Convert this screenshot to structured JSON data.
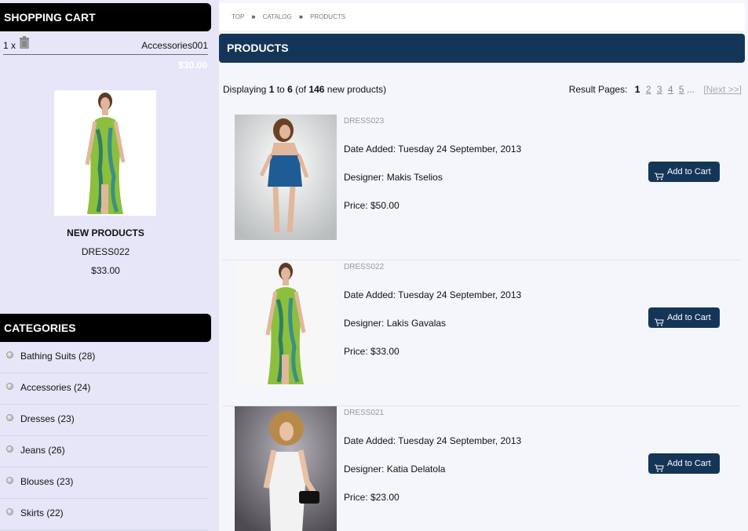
{
  "sidebar": {
    "cart": {
      "title": "Shopping Cart",
      "qty": "1 x",
      "item_name": "Accessories001",
      "total": "$30.00"
    },
    "new_products": {
      "title": "New Products",
      "name": "DRESS022",
      "price": "$33.00"
    },
    "categories": {
      "title": "Categories",
      "items": [
        {
          "label": "Bathing Suits (28)"
        },
        {
          "label": "Accessories (24)"
        },
        {
          "label": "Dresses (23)"
        },
        {
          "label": "Jeans (26)"
        },
        {
          "label": "Blouses (23)"
        },
        {
          "label": "Skirts (22)"
        }
      ]
    }
  },
  "main": {
    "breadcrumb": [
      "Top",
      "Catalog",
      "Products"
    ],
    "breadcrumb_sep": "»",
    "header": "Products",
    "displaying": {
      "prefix": "Displaying ",
      "from": "1",
      "to_word": " to ",
      "to": "6",
      "of_word": " (of ",
      "total": "146",
      "suffix": " new products)"
    },
    "result_pages": {
      "label": "Result Pages:",
      "pages": [
        "1",
        "2",
        "3",
        "4",
        "5"
      ],
      "current": "1",
      "dots": "...",
      "next": "[Next >>]"
    },
    "products": [
      {
        "code": "DRESS023",
        "date": "Date Added: Tuesday 24 September, 2013",
        "designer": "Designer: Makis Tselios",
        "price": "Price: $50.00",
        "button": "Add to Cart"
      },
      {
        "code": "DRESS022",
        "date": "Date Added: Tuesday 24 September, 2013",
        "designer": "Designer: Lakis Gavalas",
        "price": "Price: $33.00",
        "button": "Add to Cart"
      },
      {
        "code": "DRESS021",
        "date": "Date Added: Tuesday 24 September, 2013",
        "designer": "Designer: Katia Delatola",
        "price": "Price: $23.00",
        "button": "Add to Cart"
      }
    ]
  },
  "colors": {
    "header_dark": "#000000",
    "header_navy": "#153558",
    "sidebar_bg": "#e6e6f8",
    "main_bg": "#f4f6fb"
  },
  "icons": {
    "trash": "trash-icon",
    "cart": "cart-icon",
    "bullet": "bullet-icon"
  }
}
